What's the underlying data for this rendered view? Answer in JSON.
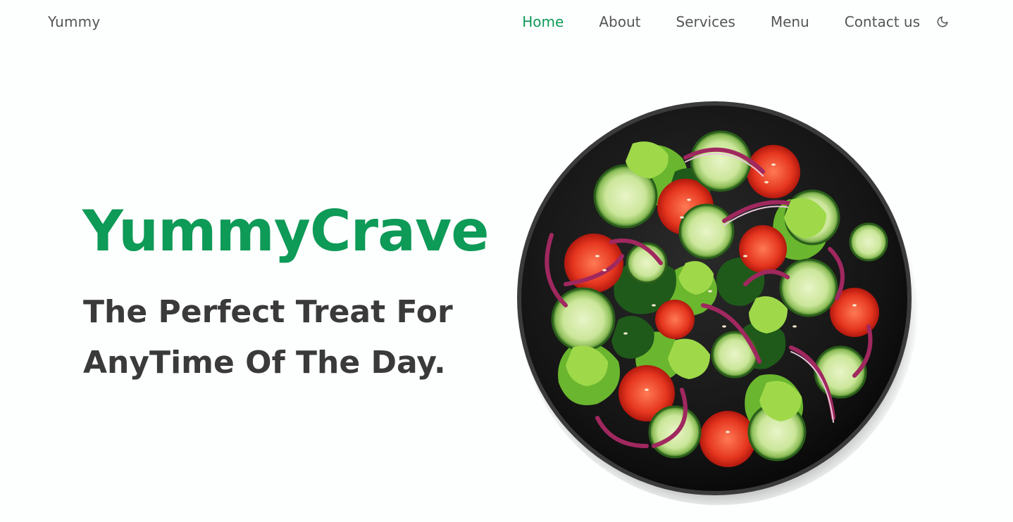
{
  "nav": {
    "brand": "Yummy",
    "links": [
      {
        "label": "Home",
        "active": true
      },
      {
        "label": "About",
        "active": false
      },
      {
        "label": "Services",
        "active": false
      },
      {
        "label": "Menu",
        "active": false
      },
      {
        "label": "Contact us",
        "active": false
      }
    ],
    "theme_icon": "moon-icon"
  },
  "hero": {
    "title": "YummyCrave",
    "subtitle_line1": "The Perfect Treat For",
    "subtitle_line2": "AnyTime Of The Day.",
    "image": "salad-bowl-image"
  },
  "colors": {
    "accent": "#0e9a57",
    "text": "#3a3a3a",
    "nav_text": "#555555",
    "background": "#fdfefe"
  }
}
